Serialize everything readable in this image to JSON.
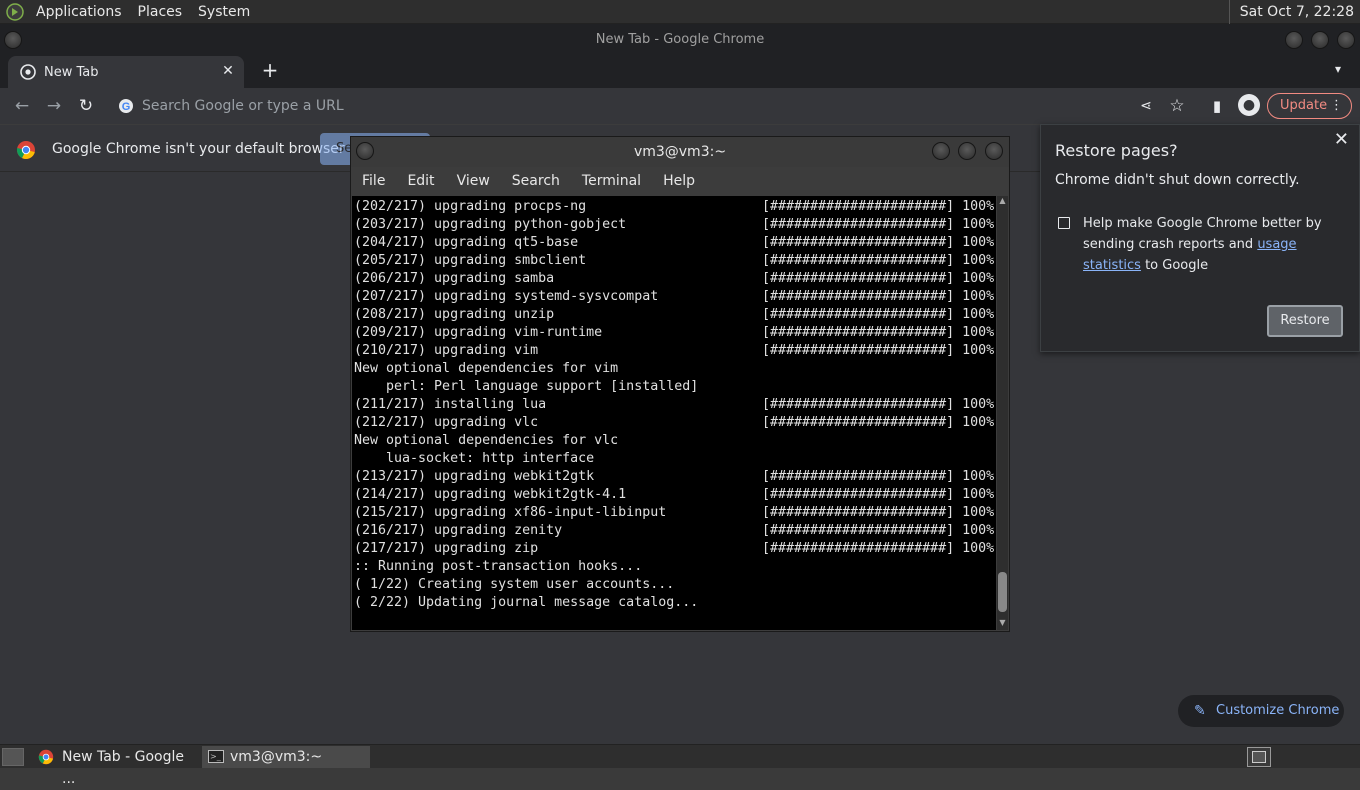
{
  "top_panel": {
    "menus": [
      "Applications",
      "Places",
      "System"
    ],
    "clock": "Sat Oct  7, 22:28"
  },
  "chrome": {
    "window_title": "New Tab - Google Chrome",
    "tab_title": "New Tab",
    "omnibox_placeholder": "Search Google or type a URL",
    "update_label": "Update",
    "infobar_message": "Google Chrome isn't your default browser",
    "infobar_button": "Se",
    "customize_label": "Customize Chrome"
  },
  "restore_popup": {
    "title": "Restore pages?",
    "subtitle": "Chrome didn't shut down correctly.",
    "checkbox_text_before": "Help make Google Chrome better by sending crash reports and ",
    "checkbox_link": "usage statistics",
    "checkbox_text_after": " to Google",
    "button": "Restore"
  },
  "terminal": {
    "title": "vm3@vm3:~",
    "menus": [
      "File",
      "Edit",
      "View",
      "Search",
      "Terminal",
      "Help"
    ],
    "lines": [
      {
        "text": "(202/217) upgrading procps-ng",
        "bar": "[######################] 100%"
      },
      {
        "text": "(203/217) upgrading python-gobject",
        "bar": "[######################] 100%"
      },
      {
        "text": "(204/217) upgrading qt5-base",
        "bar": "[######################] 100%"
      },
      {
        "text": "(205/217) upgrading smbclient",
        "bar": "[######################] 100%"
      },
      {
        "text": "(206/217) upgrading samba",
        "bar": "[######################] 100%"
      },
      {
        "text": "(207/217) upgrading systemd-sysvcompat",
        "bar": "[######################] 100%"
      },
      {
        "text": "(208/217) upgrading unzip",
        "bar": "[######################] 100%"
      },
      {
        "text": "(209/217) upgrading vim-runtime",
        "bar": "[######################] 100%"
      },
      {
        "text": "(210/217) upgrading vim",
        "bar": "[######################] 100%"
      },
      {
        "text": "New optional dependencies for vim",
        "bar": ""
      },
      {
        "text": "    perl: Perl language support [installed]",
        "bar": ""
      },
      {
        "text": "(211/217) installing lua",
        "bar": "[######################] 100%"
      },
      {
        "text": "(212/217) upgrading vlc",
        "bar": "[######################] 100%"
      },
      {
        "text": "New optional dependencies for vlc",
        "bar": ""
      },
      {
        "text": "    lua-socket: http interface",
        "bar": ""
      },
      {
        "text": "(213/217) upgrading webkit2gtk",
        "bar": "[######################] 100%"
      },
      {
        "text": "(214/217) upgrading webkit2gtk-4.1",
        "bar": "[######################] 100%"
      },
      {
        "text": "(215/217) upgrading xf86-input-libinput",
        "bar": "[######################] 100%"
      },
      {
        "text": "(216/217) upgrading zenity",
        "bar": "[######################] 100%"
      },
      {
        "text": "(217/217) upgrading zip",
        "bar": "[######################] 100%"
      },
      {
        "text": ":: Running post-transaction hooks...",
        "bar": ""
      },
      {
        "text": "( 1/22) Creating system user accounts...",
        "bar": ""
      },
      {
        "text": "( 2/22) Updating journal message catalog...",
        "bar": ""
      }
    ]
  },
  "taskbar": {
    "items": [
      "New Tab - Google ...",
      "vm3@vm3:~"
    ]
  },
  "colors": {
    "update_accent": "#f28b82",
    "link": "#8ab4f8",
    "terminal_bg": "#000000"
  }
}
